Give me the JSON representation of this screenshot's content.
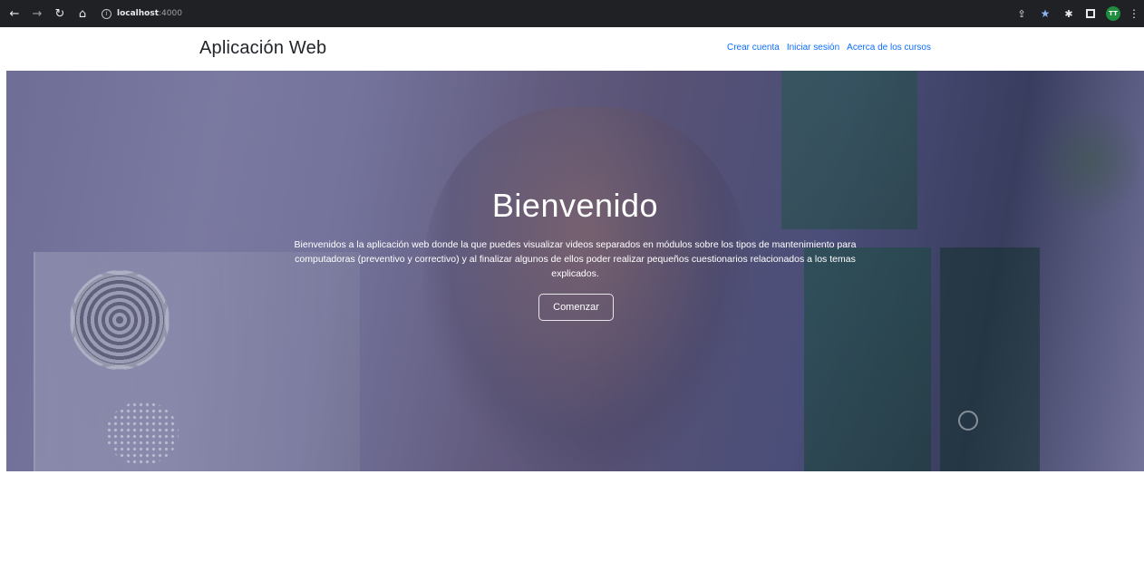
{
  "browser": {
    "url_host": "localhost",
    "url_port": ":4000"
  },
  "navbar": {
    "brand": "Aplicación Web",
    "links": [
      "Crear cuenta",
      "Iniciar sesión",
      "Acerca de los cursos"
    ]
  },
  "hero": {
    "title": "Bienvenido",
    "text": "Bienvenidos a la aplicación web donde la que puedes visualizar videos separados en módulos sobre los tipos de mantenimiento para computadoras (preventivo y correctivo) y al finalizar algunos de ellos poder realizar pequeños cuestionarios relacionados a los temas explicados.",
    "button_label": "Comenzar",
    "overlay_color": "#403c78"
  },
  "colors": {
    "link": "#0d6efd",
    "chrome_bg": "#202124"
  }
}
